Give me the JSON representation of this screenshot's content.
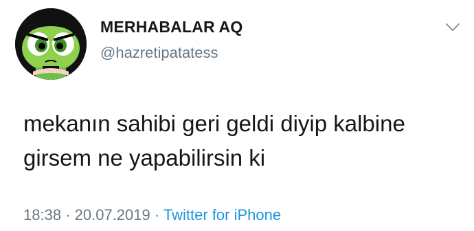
{
  "tweet": {
    "display_name": "MERHABALAR AQ",
    "handle": "@hazretipatatess",
    "text_lines": [
      "mekanın sahibi geri geldi diyip kalbine",
      "girsem ne yapabilirsin ki"
    ],
    "time": "18:38",
    "separator": "·",
    "date": "20.07.2019",
    "source": "Twitter for iPhone",
    "avatar_icon": "powerpuff-buttercup-avatar",
    "menu_icon": "chevron-down-icon"
  },
  "colors": {
    "text": "#14171a",
    "secondary": "#657786",
    "link": "#1b95e0",
    "avatar_bg": "#111111",
    "avatar_face": "#8fd14f"
  }
}
